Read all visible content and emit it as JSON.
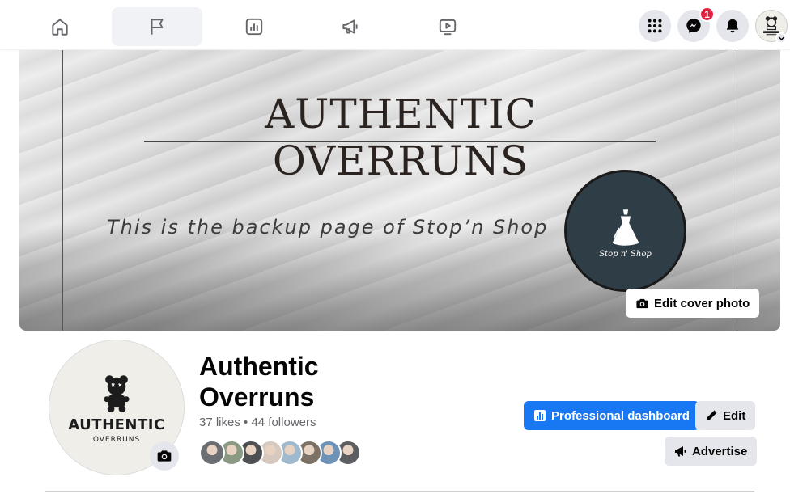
{
  "nav": {
    "tabs": [
      {
        "name": "home",
        "icon": "home-icon",
        "active": false
      },
      {
        "name": "pages",
        "icon": "flag-icon",
        "active": true
      },
      {
        "name": "insights",
        "icon": "chart-icon",
        "active": false
      },
      {
        "name": "ads",
        "icon": "megaphone-icon",
        "active": false
      },
      {
        "name": "watch",
        "icon": "video-icon",
        "active": false
      }
    ],
    "messenger_badge": "1"
  },
  "cover": {
    "title": "AUTHENTIC OVERRUNS",
    "tagline": "This is the backup page of Stop’n Shop",
    "logo_text": "Stop n' Shop",
    "edit_label": "Edit cover photo"
  },
  "profile": {
    "pic_brand": "AUTHENTIC",
    "pic_sub": "OVERRUNS",
    "name": "Authentic Overruns",
    "stats": "37 likes • 44 followers",
    "friend_colors": [
      "#6b6f74",
      "#8a9a83",
      "#4d4f52",
      "#d7c9bf",
      "#9fb9cf",
      "#7d7266",
      "#6d93b8",
      "#5c5e61"
    ]
  },
  "actions": {
    "dashboard_label": "Professional dashboard",
    "edit_label": "Edit",
    "advertise_label": "Advertise"
  },
  "colors": {
    "accent": "#1877f2",
    "badge": "#e41e3f"
  }
}
